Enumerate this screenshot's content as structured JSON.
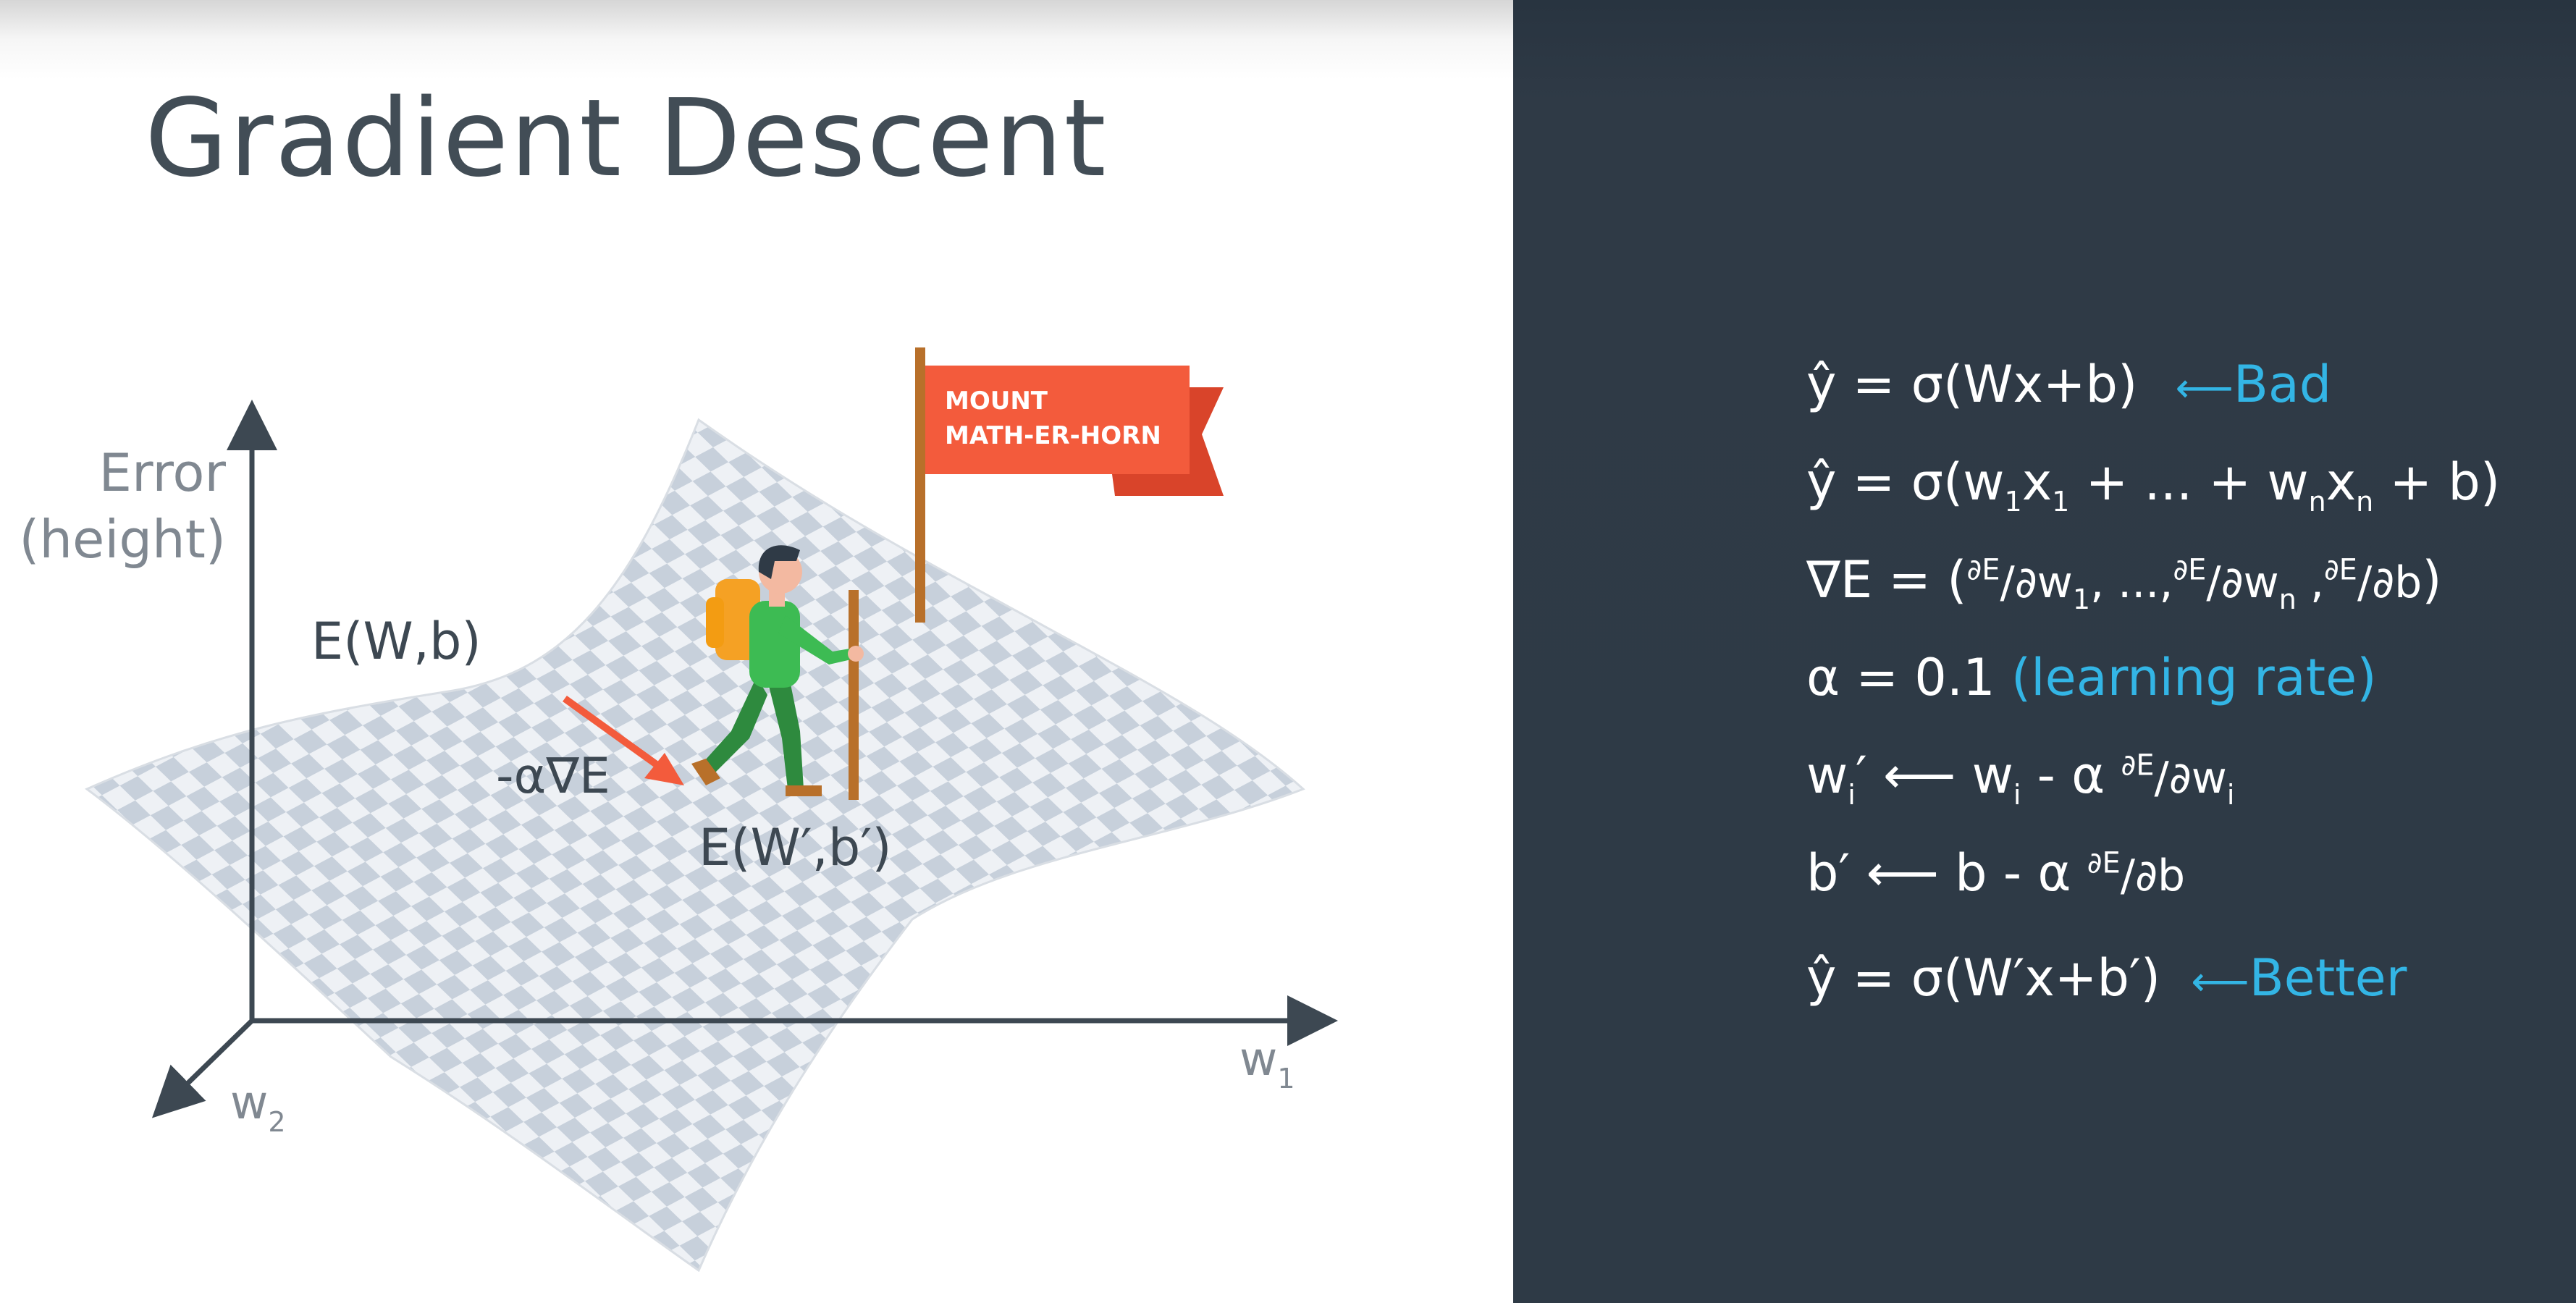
{
  "slide": {
    "title": "Gradient Descent"
  },
  "diagram": {
    "y_axis_label_line1": "Error",
    "y_axis_label_line2": "(height)",
    "x_axis_label": "w",
    "x_axis_sub": "1",
    "z_axis_label": "w",
    "z_axis_sub": "2",
    "surface_label": "E(W,b)",
    "step_label": "-α∇E",
    "new_point_label": "E(W′,b′)",
    "flag_line1": "MOUNT",
    "flag_line2": "MATH-ER-HORN",
    "colors": {
      "flag": "#f35b3c",
      "flag_dark": "#d9442a",
      "arrow": "#f35b3c",
      "axes": "#3d4852",
      "shirt": "#3dbb53",
      "pants": "#2e8a3e",
      "backpack": "#f5a124"
    }
  },
  "equations": {
    "eq1": "ŷ = σ(Wx+b)",
    "eq1_note_arrow": "⟵",
    "eq1_note": "Bad",
    "eq2_a": "ŷ = σ(w",
    "eq2_s1": "1",
    "eq2_b": "x",
    "eq2_s2": "1",
    "eq2_c": " + ... + w",
    "eq2_s3": "n",
    "eq2_d": "x",
    "eq2_s4": "n",
    "eq2_e": " + b)",
    "eq3_a": "∇E = (",
    "eq3_f1": "∂E",
    "eq3_d1": "/∂w",
    "eq3_s1": "1",
    "eq3_mid": ", ...,",
    "eq3_f2": "∂E",
    "eq3_d2": "/∂w",
    "eq3_s2": "n",
    "eq3_comma": " ,",
    "eq3_f3": "∂E",
    "eq3_d3": "/∂b",
    "eq3_end": ")",
    "eq4_a": "α =  0.1 ",
    "eq4_note": "(learning rate)",
    "eq5_a": "w",
    "eq5_s1": "i",
    "eq5_b": "′ ⟵ w",
    "eq5_s2": "i",
    "eq5_c": " - α  ",
    "eq5_f": "∂E",
    "eq5_d": "/∂w",
    "eq5_s3": "i",
    "eq6_a": "b′ ⟵ b - α  ",
    "eq6_f": "∂E",
    "eq6_d": "/∂b",
    "eq7": "ŷ = σ(W′x+b′)",
    "eq7_note_arrow": "⟵",
    "eq7_note": "Better"
  }
}
